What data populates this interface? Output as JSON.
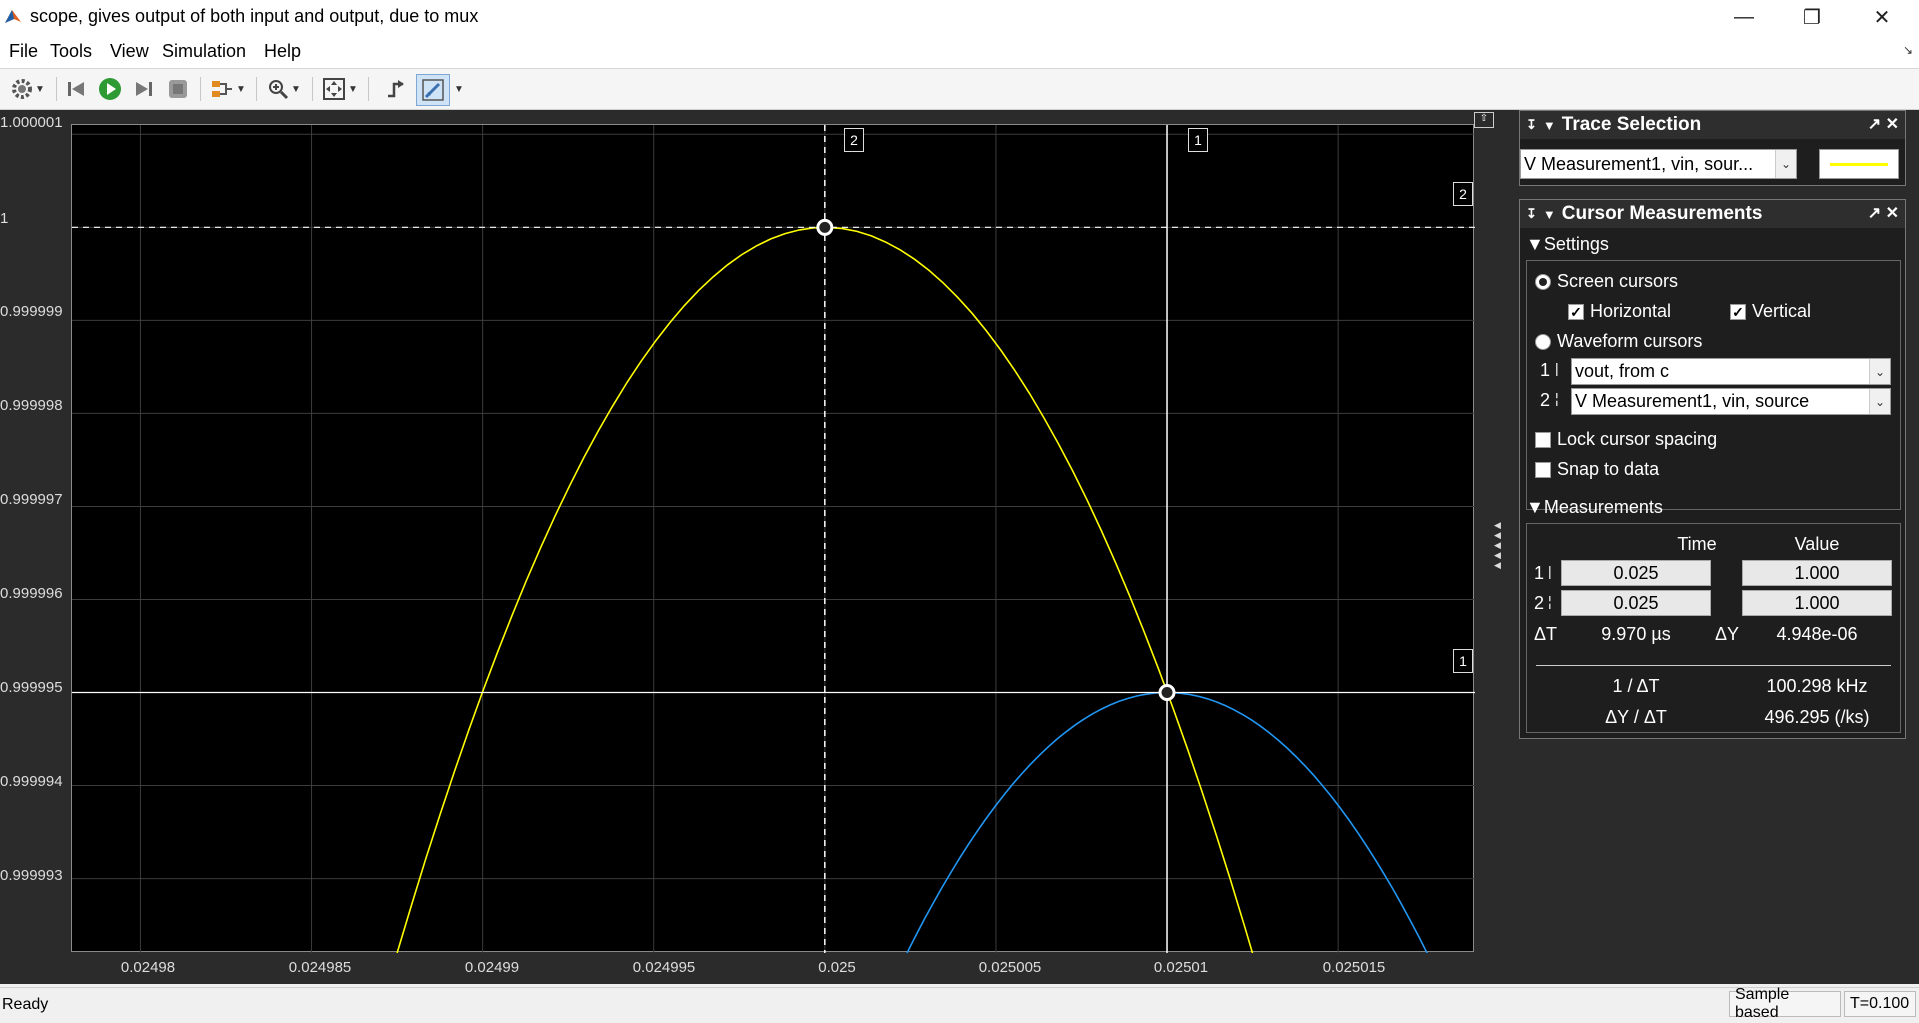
{
  "window": {
    "title": "scope, gives output of both input and output, due to mux"
  },
  "menu": [
    "File",
    "Tools",
    "View",
    "Simulation",
    "Help"
  ],
  "toolbar": {
    "icons": [
      "gear-icon",
      "step-back-icon",
      "run-icon",
      "step-forward-icon",
      "stop-icon",
      "highlight-block-icon",
      "zoom-icon",
      "scale-axes-icon",
      "triggers-icon",
      "cursor-measurements-icon"
    ]
  },
  "plot": {
    "y_ticks": [
      "1.000001",
      "1",
      "0.999999",
      "0.999998",
      "0.999997",
      "0.999996",
      "0.999995",
      "0.999994",
      "0.999993"
    ],
    "x_ticks": [
      "0.02498",
      "0.024985",
      "0.02499",
      "0.024995",
      "0.025",
      "0.025005",
      "0.02501",
      "0.025015"
    ],
    "cursor_1_label": "1",
    "cursor_2_label": "2",
    "colors": {
      "trace_yellow": "#ffff00",
      "trace_blue": "#2196f3",
      "background": "#000000",
      "grid": "#3a3a3a"
    }
  },
  "chart_data": {
    "type": "line",
    "x_range": [
      0.024978,
      0.025019
    ],
    "y_range": [
      0.9999922,
      1.0000011
    ],
    "series": [
      {
        "color": "#ffff00",
        "peak": [
          0.025,
          1.0
        ],
        "points": [
          [
            0.0249875,
            0.9999922
          ],
          [
            0.02499,
            0.999995
          ],
          [
            0.024995,
            0.9999987
          ],
          [
            0.025,
            1.0
          ],
          [
            0.025005,
            0.9999987
          ],
          [
            0.02501,
            0.999995
          ],
          [
            0.0250127,
            0.9999922
          ]
        ]
      },
      {
        "color": "#2196f3",
        "peak": [
          0.02501,
          0.999995
        ],
        "points": [
          [
            0.0250024,
            0.9999922
          ],
          [
            0.025005,
            0.9999938
          ],
          [
            0.02501,
            0.999995
          ],
          [
            0.025015,
            0.9999938
          ],
          [
            0.0250179,
            0.9999922
          ]
        ]
      }
    ],
    "cursors": {
      "vertical": {
        "1": 0.02501,
        "2": 0.025
      },
      "horizontal": {
        "1": 0.999995,
        "2": 1.0
      }
    },
    "grid": true
  },
  "trace_selection": {
    "title": "Trace Selection",
    "selected": "V Measurement1, vin, sour...",
    "line_color": "#ffff00"
  },
  "cursor_measurements": {
    "title": "Cursor Measurements",
    "settings": {
      "section_label": "Settings",
      "screen_cursors": "Screen cursors",
      "horizontal": "Horizontal",
      "vertical": "Vertical",
      "waveform_cursors": "Waveform cursors",
      "cursor1_label": "1",
      "cursor1_value": "vout, from c",
      "cursor2_label": "2",
      "cursor2_value": "V Measurement1, vin, source",
      "lock_spacing": "Lock cursor spacing",
      "snap_to_data": "Snap to data"
    },
    "measurements": {
      "section_label": "Measurements",
      "col_time": "Time",
      "col_value": "Value",
      "row1_label": "1",
      "row1_time": "0.025",
      "row1_value": "1.000",
      "row2_label": "2",
      "row2_time": "0.025",
      "row2_value": "1.000",
      "delta_t_label": "ΔT",
      "delta_t": "9.970 µs",
      "delta_y_label": "ΔY",
      "delta_y": "4.948e-06",
      "inv_dt_label": "1 / ΔT",
      "inv_dt": "100.298 kHz",
      "dy_dt_label": "ΔY / ΔT",
      "dy_dt": "496.295 (/ks)"
    }
  },
  "status": {
    "left": "Ready",
    "mode": "Sample based",
    "time": "T=0.100"
  }
}
